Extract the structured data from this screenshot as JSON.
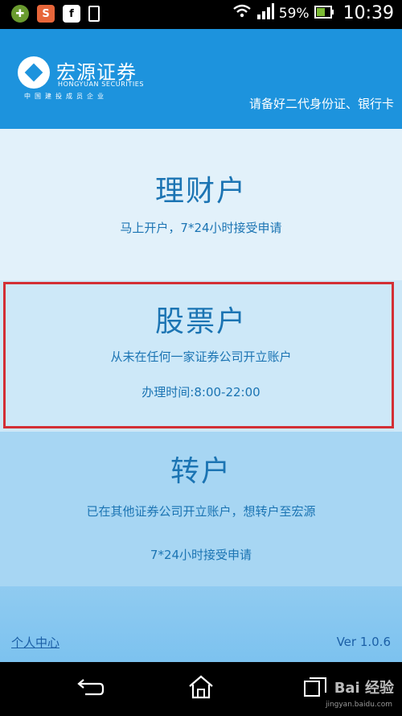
{
  "status_bar": {
    "battery": "59%",
    "time": "10:39"
  },
  "header": {
    "logo_cn": "宏源证券",
    "logo_en": "HONGYUAN SECURITIES",
    "logo_tagline": "中国建投成员企业",
    "note": "请备好二代身份证、银行卡"
  },
  "cards": {
    "financial": {
      "title": "理财户",
      "desc": "马上开户，7*24小时接受申请"
    },
    "stock": {
      "title": "股票户",
      "desc": "从未在任何一家证券公司开立账户",
      "hours": "办理时间:8:00-22:00"
    },
    "transfer": {
      "title": "转户",
      "desc": "已在其他证券公司开立账户，想转户至宏源",
      "hours": "7*24小时接受申请"
    }
  },
  "footer": {
    "personal_center": "个人中心",
    "version": "Ver 1.0.6"
  },
  "watermark": {
    "text": "Bai 经验",
    "url": "jingyan.baidu.com"
  }
}
